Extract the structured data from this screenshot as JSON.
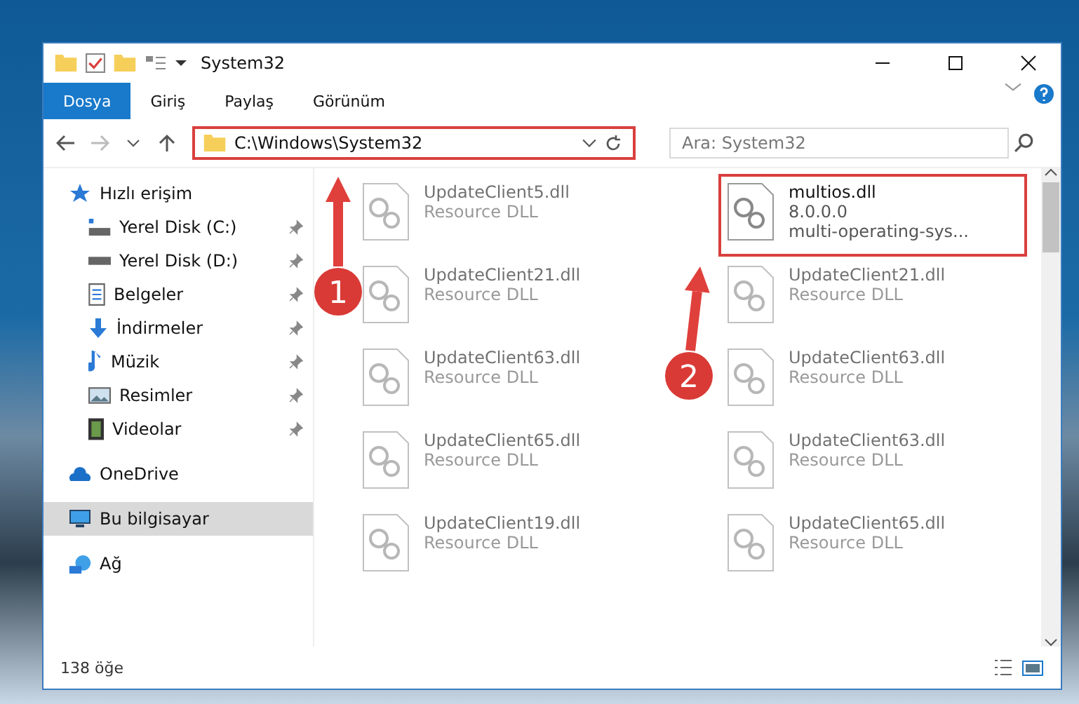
{
  "window": {
    "title": "System32"
  },
  "ribbon_tabs": [
    {
      "label": "Dosya",
      "selected": true
    },
    {
      "label": "Giriş",
      "selected": false
    },
    {
      "label": "Paylaş",
      "selected": false
    },
    {
      "label": "Görünüm",
      "selected": false
    }
  ],
  "address": {
    "value": "C:\\Windows\\System32",
    "highlighted": true
  },
  "search": {
    "placeholder": "Ara: System32"
  },
  "sidebar": {
    "items": [
      {
        "label": "Hızlı erişim",
        "pinned": false,
        "selected": false,
        "children": [
          {
            "label": "Yerel Disk (C:)",
            "pinned": true,
            "selected": false
          },
          {
            "label": "Yerel Disk (D:)",
            "pinned": true,
            "selected": false
          },
          {
            "label": "Belgeler",
            "pinned": true,
            "selected": false
          },
          {
            "label": "İndirmeler",
            "pinned": true,
            "selected": false
          },
          {
            "label": "Müzik",
            "pinned": true,
            "selected": false
          },
          {
            "label": "Resimler",
            "pinned": true,
            "selected": false
          },
          {
            "label": "Videolar",
            "pinned": true,
            "selected": false
          }
        ]
      },
      {
        "label": "OneDrive",
        "pinned": false,
        "selected": false
      },
      {
        "label": "Bu bilgisayar",
        "pinned": false,
        "selected": true
      },
      {
        "label": "Ağ",
        "pinned": false,
        "selected": false
      }
    ]
  },
  "files": [
    {
      "name": "UpdateClient5.dll",
      "line_2": "Resource DLL",
      "faded": true,
      "highlighted": false
    },
    {
      "name": "multios.dll",
      "line_2": "8.0.0.0",
      "line_3": "multi-operating-sys...",
      "faded": false,
      "highlighted": true
    },
    {
      "name": "UpdateClient21.dll",
      "line_2": "Resource DLL",
      "faded": true,
      "highlighted": false
    },
    {
      "name": "UpdateClient21.dll",
      "line_2": "Resource DLL",
      "faded": true,
      "highlighted": false
    },
    {
      "name": "UpdateClient63.dll",
      "line_2": "Resource DLL",
      "faded": true,
      "highlighted": false
    },
    {
      "name": "UpdateClient63.dll",
      "line_2": "Resource DLL",
      "faded": true,
      "highlighted": false
    },
    {
      "name": "UpdateClient65.dll",
      "line_2": "Resource DLL",
      "faded": true,
      "highlighted": false
    },
    {
      "name": "UpdateClient63.dll",
      "line_2": "Resource DLL",
      "faded": true,
      "highlighted": false
    },
    {
      "name": "UpdateClient19.dll",
      "line_2": "Resource DLL",
      "faded": true,
      "highlighted": false
    },
    {
      "name": "UpdateClient65.dll",
      "line_2": "Resource DLL",
      "faded": true,
      "highlighted": false
    }
  ],
  "status_bar": {
    "count": "138 öğe"
  },
  "callouts": [
    {
      "number": "1"
    },
    {
      "number": "2"
    }
  ]
}
